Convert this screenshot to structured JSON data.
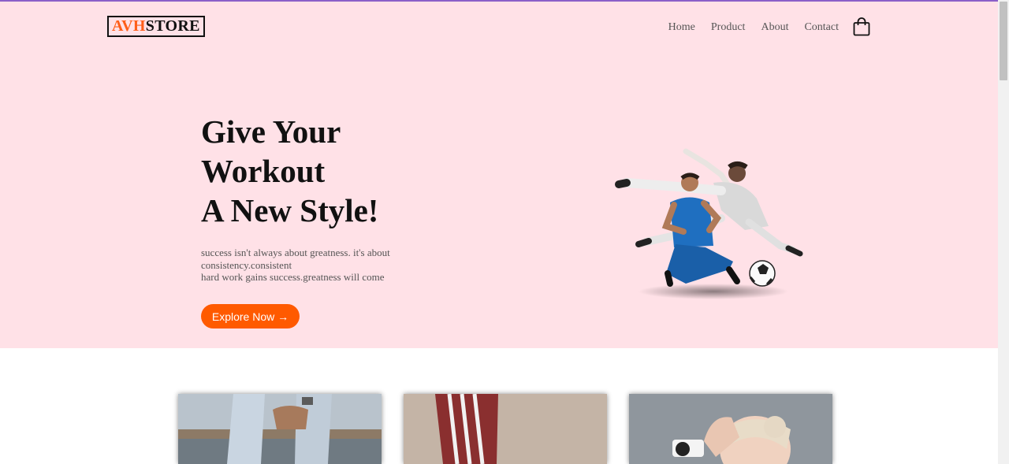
{
  "brand": {
    "accent": "AVH",
    "rest": "STORE",
    "accent_color": "#ff5e1a"
  },
  "nav": {
    "items": [
      {
        "label": "Home"
      },
      {
        "label": "Product"
      },
      {
        "label": "About"
      },
      {
        "label": "Contact"
      }
    ],
    "cart_icon": "shopping-bag-icon"
  },
  "hero": {
    "headline_lines": [
      "Give Your",
      "Workout",
      "A New Style!"
    ],
    "description_lines": [
      "success isn't always about greatness. it's about",
      "consistency.consistent",
      "hard work gains success.greatness will come"
    ],
    "cta_label": "Explore Now →",
    "cta_color": "#ff5a00",
    "background": "#ffe1e7",
    "image": "football-players-image"
  },
  "featured": {
    "cards": [
      {
        "image": "jeans-and-watch-image"
      },
      {
        "image": "striped-track-pants-image"
      },
      {
        "image": "woman-with-smartwatch-image"
      }
    ]
  }
}
